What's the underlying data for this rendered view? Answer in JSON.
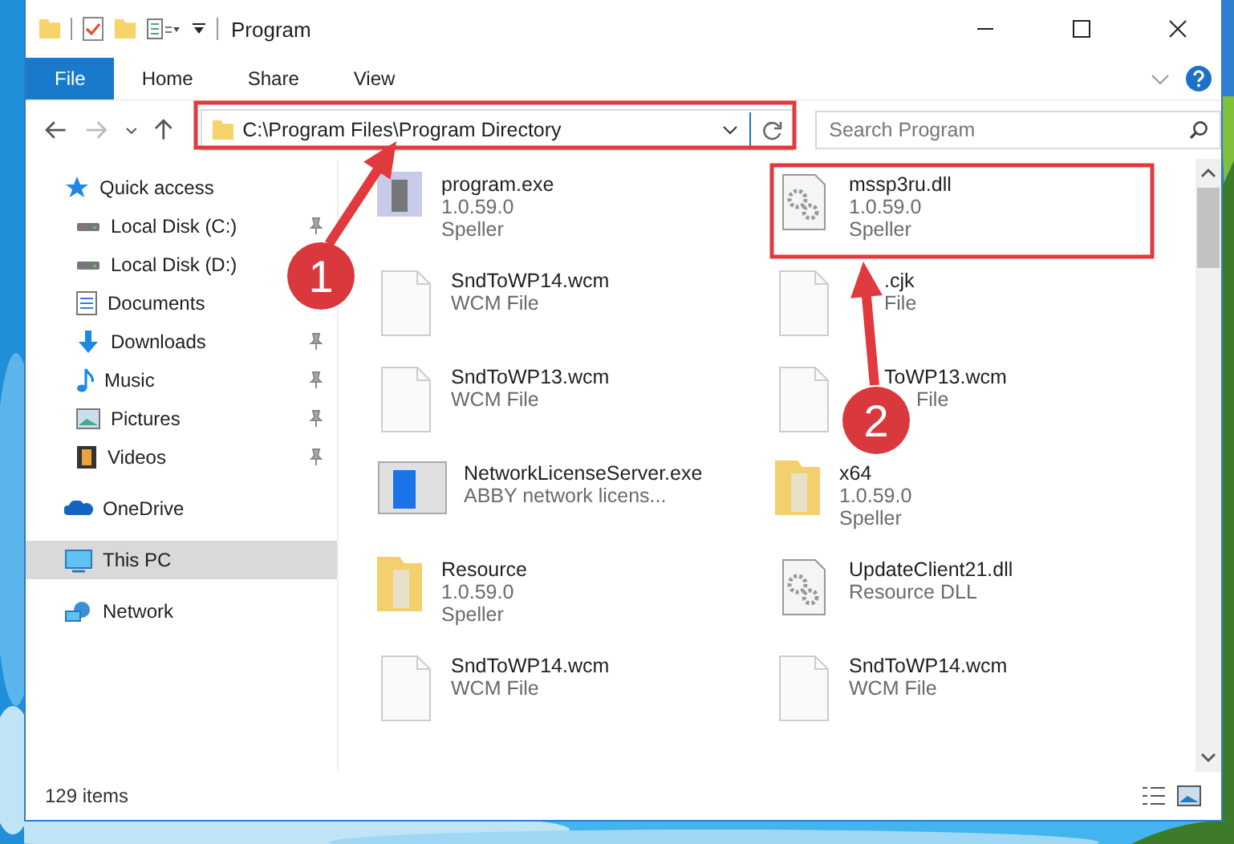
{
  "window": {
    "title": "Program"
  },
  "ribbon_tabs": [
    {
      "label": "File",
      "selected": true
    },
    {
      "label": "Home",
      "selected": false
    },
    {
      "label": "Share",
      "selected": false
    },
    {
      "label": "View",
      "selected": false
    }
  ],
  "address": {
    "value": "C:\\Program Files\\Program Directory"
  },
  "search": {
    "placeholder": "Search Program"
  },
  "sidebar": {
    "items": [
      {
        "label": "Quick access",
        "selected": false,
        "children": [
          {
            "label": "Local Disk (C:)",
            "pinned": true
          },
          {
            "label": "Local Disk (D:)",
            "pinned": false
          },
          {
            "label": "Documents",
            "pinned": false
          },
          {
            "label": "Downloads",
            "pinned": true
          },
          {
            "label": "Music",
            "pinned": true
          },
          {
            "label": "Pictures",
            "pinned": true
          },
          {
            "label": "Videos",
            "pinned": true
          }
        ]
      },
      {
        "label": "OneDrive",
        "selected": false
      },
      {
        "label": "This PC",
        "selected": true
      },
      {
        "label": "Network",
        "selected": false
      }
    ]
  },
  "files": [
    {
      "name": "program.exe",
      "details": [
        "1.0.59.0",
        "Speller"
      ]
    },
    {
      "name": "mssp3ru.dll",
      "details": [
        "1.0.59.0",
        "Speller"
      ]
    },
    {
      "name": "SndToWP14.wcm",
      "details": [
        "WCM File"
      ]
    },
    {
      "name": ".cjk",
      "details": [
        "File"
      ]
    },
    {
      "name": "SndToWP13.wcm",
      "details": [
        "WCM File"
      ]
    },
    {
      "name": "ToWP13.wcm",
      "details": [
        "File"
      ]
    },
    {
      "name": "NetworkLicenseServer.exe",
      "details": [
        "ABBY network licens..."
      ]
    },
    {
      "name": "x64",
      "details": [
        "1.0.59.0",
        "Speller"
      ]
    },
    {
      "name": "Resource",
      "details": [
        "1.0.59.0",
        "Speller"
      ]
    },
    {
      "name": "UpdateClient21.dll",
      "details": [
        "Resource DLL"
      ]
    },
    {
      "name": "SndToWP14.wcm",
      "details": [
        "WCM File"
      ]
    },
    {
      "name": "SndToWP14.wcm",
      "details": [
        "WCM File"
      ]
    }
  ],
  "status_bar": {
    "count": "129 items"
  },
  "annotations": [
    {
      "number": "1"
    },
    {
      "number": "2"
    }
  ]
}
